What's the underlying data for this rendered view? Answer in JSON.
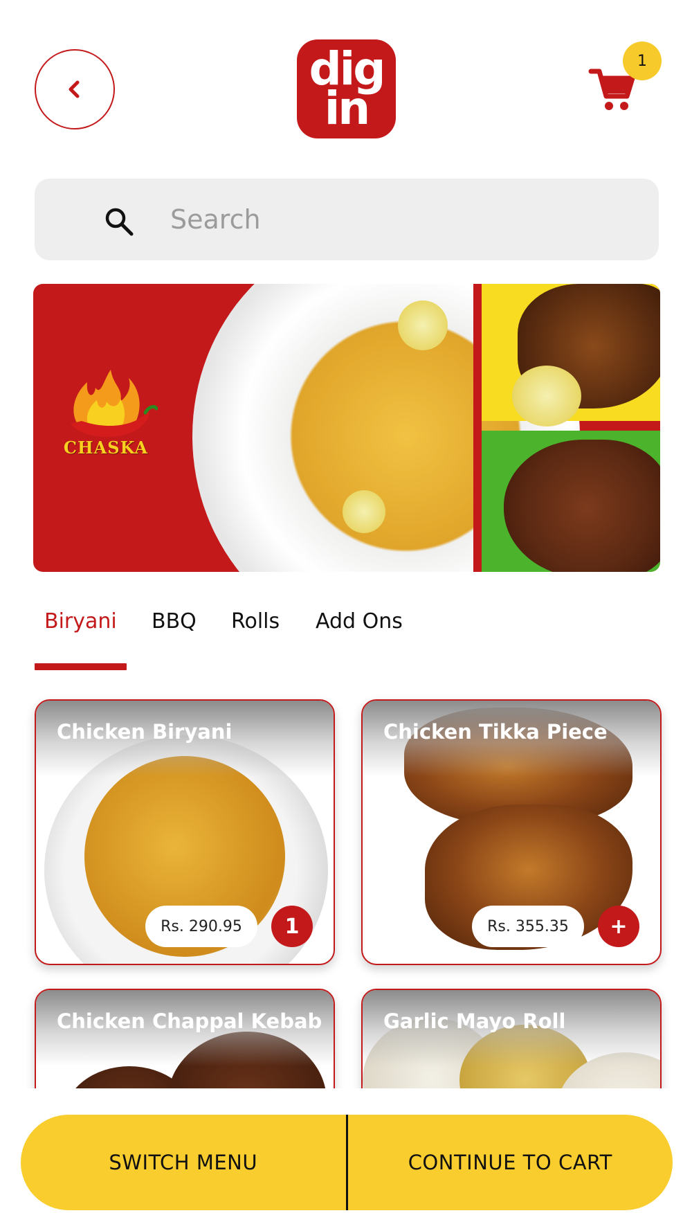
{
  "header": {
    "back_icon": "chevron-left-icon",
    "logo": {
      "line1": "dig",
      "line2": "in"
    },
    "cart_icon": "shopping-cart-icon",
    "cart_count": "1"
  },
  "search": {
    "placeholder": "Search",
    "icon": "search-icon"
  },
  "banner": {
    "brand_text": "CHASKA"
  },
  "tabs": [
    {
      "label": "Biryani",
      "active": true
    },
    {
      "label": "BBQ",
      "active": false
    },
    {
      "label": "Rolls",
      "active": false
    },
    {
      "label": "Add Ons",
      "active": false
    }
  ],
  "products": [
    {
      "name": "Chicken Biryani",
      "price": "Rs. 290.95",
      "qty": "1"
    },
    {
      "name": "Chicken Tikka Piece",
      "price": "Rs. 355.35",
      "add_label": "+"
    },
    {
      "name": "Chicken Chappal Kebab"
    },
    {
      "name": "Garlic Mayo Roll"
    }
  ],
  "bottom": {
    "switch_label": "SWITCH MENU",
    "cart_label": "CONTINUE TO CART"
  },
  "colors": {
    "primary_red": "#c4191a",
    "accent_yellow": "#f9cd2d"
  }
}
